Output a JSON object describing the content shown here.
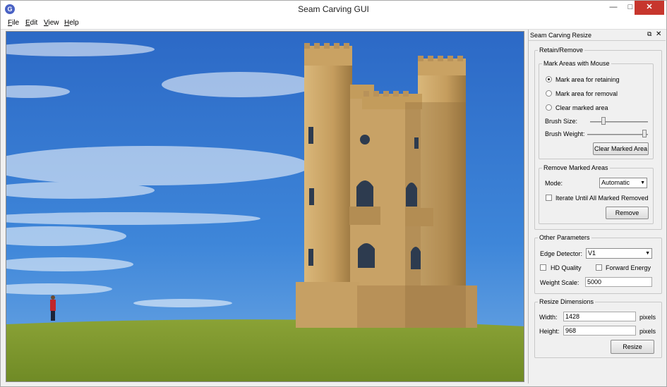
{
  "window": {
    "title": "Seam Carving GUI",
    "app_icon": "G"
  },
  "menu": {
    "file": "File",
    "edit": "Edit",
    "view": "View",
    "help": "Help"
  },
  "panel": {
    "title": "Seam Carving Resize",
    "retain_remove": {
      "legend": "Retain/Remove",
      "mark_areas": {
        "legend": "Mark Areas with Mouse",
        "opt_retain": "Mark area for retaining",
        "opt_removal": "Mark area for removal",
        "opt_clear": "Clear marked area",
        "selected": "retain",
        "brush_size_label": "Brush Size:",
        "brush_size_value": 0.2,
        "brush_weight_label": "Brush Weight:",
        "brush_weight_value": 1.0,
        "clear_button": "Clear Marked Area"
      },
      "remove_marked": {
        "legend": "Remove Marked Areas",
        "mode_label": "Mode:",
        "mode_value": "Automatic",
        "iterate_label": "Iterate Until All Marked Removed",
        "iterate_checked": false,
        "remove_button": "Remove"
      }
    },
    "other": {
      "legend": "Other Parameters",
      "edge_label": "Edge Detector:",
      "edge_value": "V1",
      "hd_label": "HD Quality",
      "hd_checked": false,
      "forward_label": "Forward Energy",
      "forward_checked": false,
      "weight_scale_label": "Weight Scale:",
      "weight_scale_value": "5000"
    },
    "resize": {
      "legend": "Resize Dimensions",
      "width_label": "Width:",
      "width_value": "1428",
      "height_label": "Height:",
      "height_value": "968",
      "unit": "pixels",
      "resize_button": "Resize"
    }
  }
}
